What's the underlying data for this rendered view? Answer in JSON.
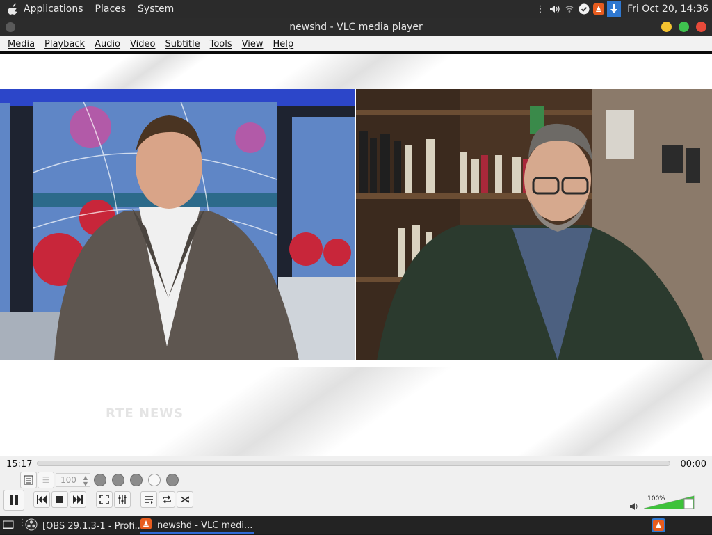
{
  "top_panel": {
    "menus": [
      "Applications",
      "Places",
      "System"
    ],
    "clock": "Fri Oct 20, 14:36"
  },
  "window": {
    "title": "newshd - VLC media player"
  },
  "menubar": {
    "items": [
      "Media",
      "Playback",
      "Audio",
      "Video",
      "Subtitle",
      "Tools",
      "View",
      "Help"
    ]
  },
  "video": {
    "logo_text": "RTE NEWS"
  },
  "controls": {
    "elapsed": "15:17",
    "remaining": "00:00",
    "speed_value": "100",
    "volume_label": "100%",
    "volume_level": 1.0
  },
  "taskbar": {
    "tasks": [
      "[OBS 29.1.3-1 - Profi...",
      "newshd - VLC medi..."
    ]
  }
}
